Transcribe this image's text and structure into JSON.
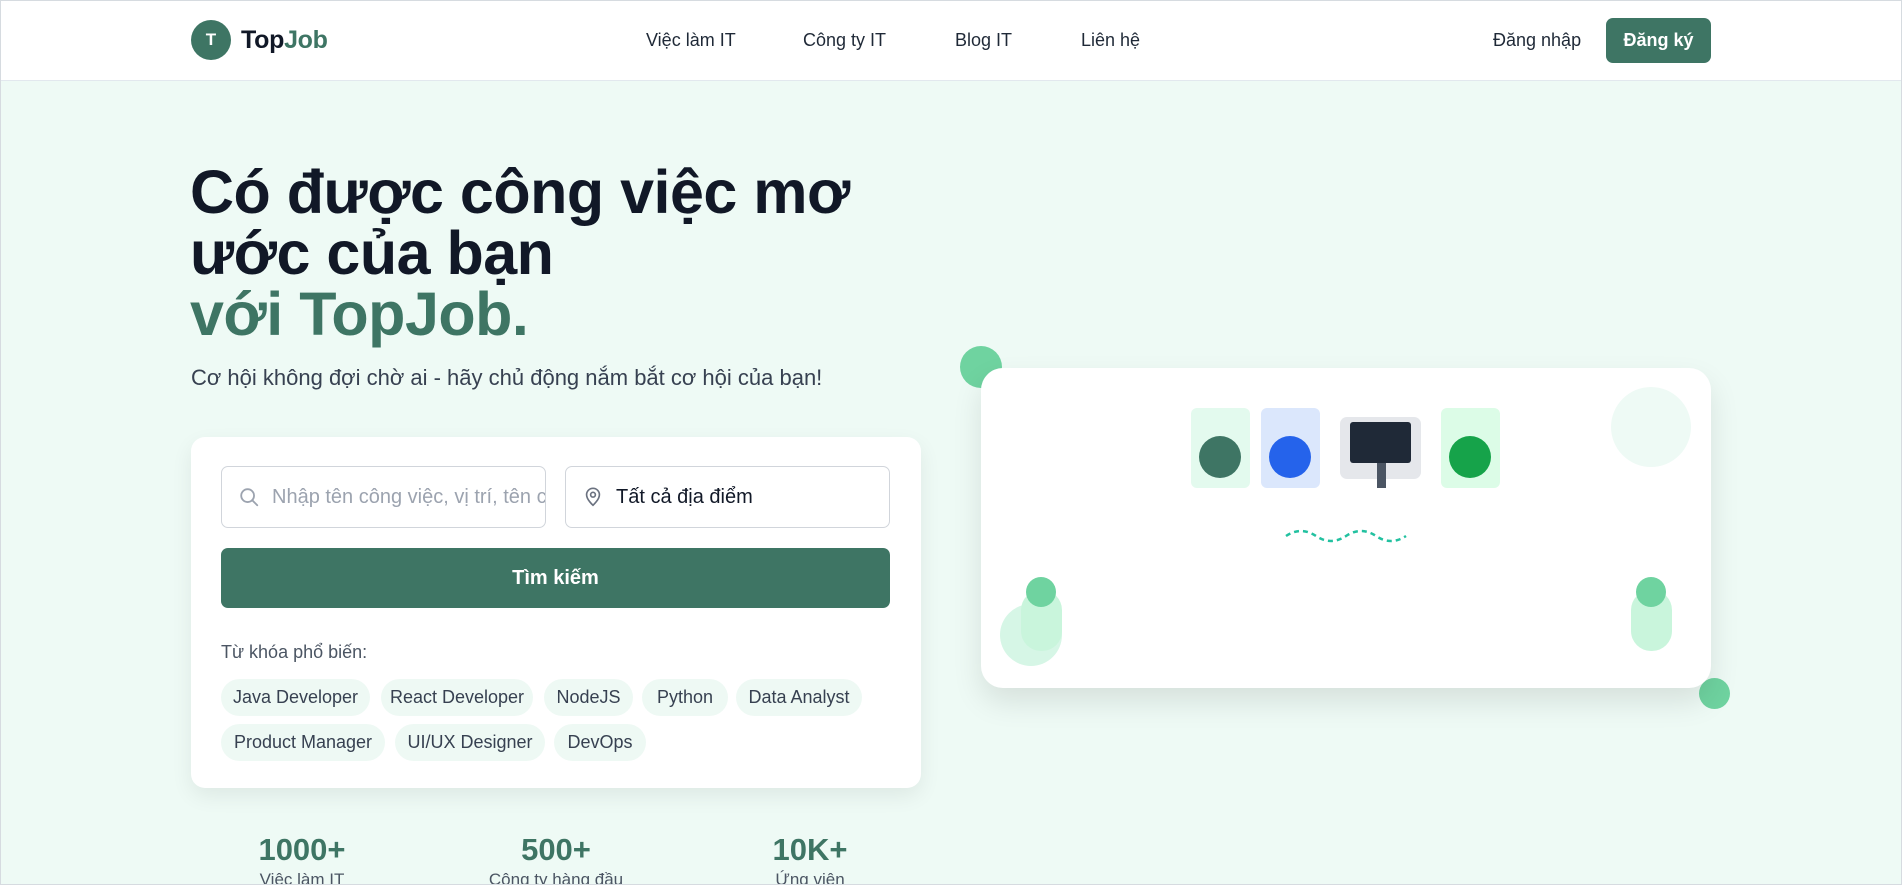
{
  "brand": {
    "initial": "T",
    "name_part1": "Top",
    "name_part2": "Job"
  },
  "nav": {
    "items": [
      "Việc làm IT",
      "Công ty IT",
      "Blog IT",
      "Liên hệ"
    ],
    "login": "Đăng nhập",
    "signup": "Đăng ký"
  },
  "hero": {
    "title_line": "Có được công việc mơ ước của bạn",
    "title_accent": "với TopJob.",
    "subtitle": "Cơ hội không đợi chờ ai - hãy chủ động nắm bắt cơ hội của bạn!"
  },
  "search": {
    "keyword_placeholder": "Nhập tên công việc, vị trí, tên công ty...",
    "keyword_value": "",
    "location_value": "Tất cả địa điểm",
    "button": "Tìm kiếm",
    "popular_label": "Từ khóa phổ biến:",
    "keywords": [
      "Java Developer",
      "React Developer",
      "NodeJS",
      "Python",
      "Data Analyst",
      "Product Manager",
      "UI/UX Designer",
      "DevOps"
    ]
  },
  "stats": [
    {
      "value": "1000+",
      "label": "Việc làm IT"
    },
    {
      "value": "500+",
      "label": "Công ty hàng đầu"
    },
    {
      "value": "10K+",
      "label": "Ứng viên"
    }
  ],
  "colors": {
    "brand": "#3e7564",
    "background": "#eefaf5",
    "chip_bg": "#eef9f4",
    "accent_green": "#6fd3a0"
  },
  "icons": [
    "search-icon",
    "location-pin-icon"
  ]
}
